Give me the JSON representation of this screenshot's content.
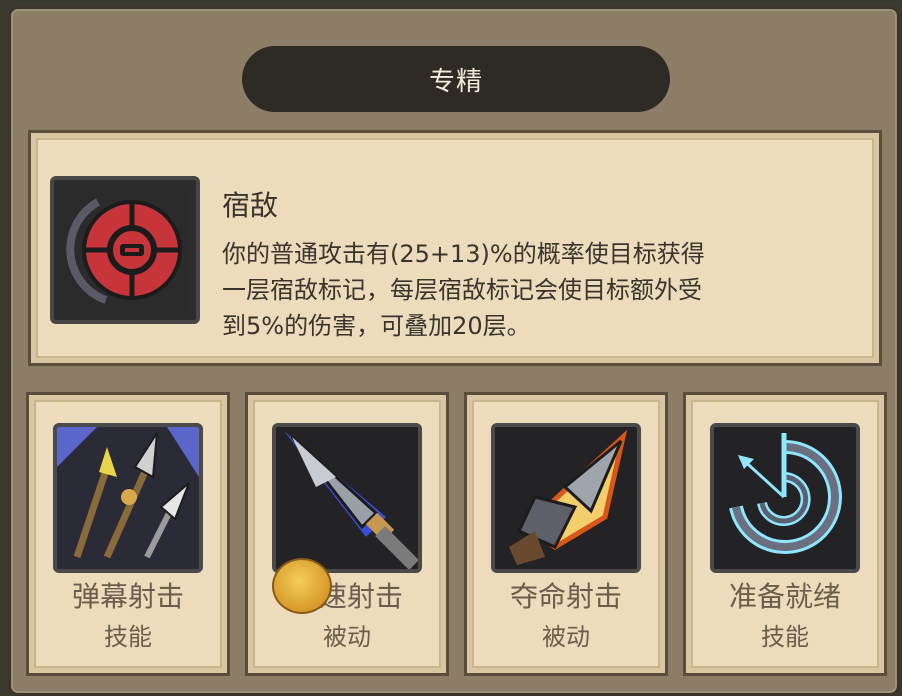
{
  "panel": {
    "title": "专精"
  },
  "selected_skill": {
    "name": "宿敌",
    "description": "你的普通攻击有(25+13)%的概率使目标获得\n一层宿敌标记，每层宿敌标记会使目标额外受\n到5%的伤害，可叠加20层。",
    "icon": "nemesis-target-icon"
  },
  "skills": [
    {
      "name": "弹幕射击",
      "type": "技能",
      "icon": "barrage-arrows-icon"
    },
    {
      "name": "快速射击",
      "type": "被动",
      "icon": "quick-shot-arrowhead-icon"
    },
    {
      "name": "夺命射击",
      "type": "被动",
      "icon": "deadly-shot-arrowhead-icon"
    },
    {
      "name": "准备就绪",
      "type": "技能",
      "icon": "ready-spiral-icon"
    }
  ],
  "colors": {
    "panel_bg": "#8c7d67",
    "parchment": "#ecdcbc",
    "title_bar": "#2e2a24",
    "text_dark": "#3b342c",
    "text_muted": "#6a5e4c",
    "nemesis_red": "#c7343a",
    "frost_blue": "#8fe6ff",
    "coin_gold": "#f2c04a"
  }
}
